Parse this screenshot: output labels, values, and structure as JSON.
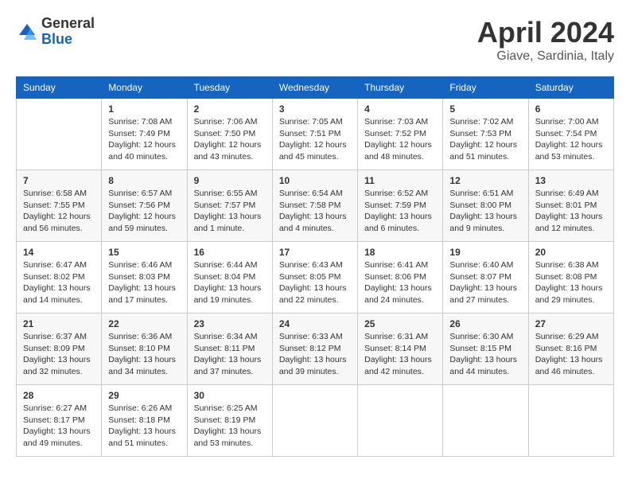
{
  "header": {
    "logo_general": "General",
    "logo_blue": "Blue",
    "month_title": "April 2024",
    "location": "Giave, Sardinia, Italy"
  },
  "days_of_week": [
    "Sunday",
    "Monday",
    "Tuesday",
    "Wednesday",
    "Thursday",
    "Friday",
    "Saturday"
  ],
  "weeks": [
    [
      {
        "day": "",
        "sunrise": "",
        "sunset": "",
        "daylight": ""
      },
      {
        "day": "1",
        "sunrise": "Sunrise: 7:08 AM",
        "sunset": "Sunset: 7:49 PM",
        "daylight": "Daylight: 12 hours and 40 minutes."
      },
      {
        "day": "2",
        "sunrise": "Sunrise: 7:06 AM",
        "sunset": "Sunset: 7:50 PM",
        "daylight": "Daylight: 12 hours and 43 minutes."
      },
      {
        "day": "3",
        "sunrise": "Sunrise: 7:05 AM",
        "sunset": "Sunset: 7:51 PM",
        "daylight": "Daylight: 12 hours and 45 minutes."
      },
      {
        "day": "4",
        "sunrise": "Sunrise: 7:03 AM",
        "sunset": "Sunset: 7:52 PM",
        "daylight": "Daylight: 12 hours and 48 minutes."
      },
      {
        "day": "5",
        "sunrise": "Sunrise: 7:02 AM",
        "sunset": "Sunset: 7:53 PM",
        "daylight": "Daylight: 12 hours and 51 minutes."
      },
      {
        "day": "6",
        "sunrise": "Sunrise: 7:00 AM",
        "sunset": "Sunset: 7:54 PM",
        "daylight": "Daylight: 12 hours and 53 minutes."
      }
    ],
    [
      {
        "day": "7",
        "sunrise": "Sunrise: 6:58 AM",
        "sunset": "Sunset: 7:55 PM",
        "daylight": "Daylight: 12 hours and 56 minutes."
      },
      {
        "day": "8",
        "sunrise": "Sunrise: 6:57 AM",
        "sunset": "Sunset: 7:56 PM",
        "daylight": "Daylight: 12 hours and 59 minutes."
      },
      {
        "day": "9",
        "sunrise": "Sunrise: 6:55 AM",
        "sunset": "Sunset: 7:57 PM",
        "daylight": "Daylight: 13 hours and 1 minute."
      },
      {
        "day": "10",
        "sunrise": "Sunrise: 6:54 AM",
        "sunset": "Sunset: 7:58 PM",
        "daylight": "Daylight: 13 hours and 4 minutes."
      },
      {
        "day": "11",
        "sunrise": "Sunrise: 6:52 AM",
        "sunset": "Sunset: 7:59 PM",
        "daylight": "Daylight: 13 hours and 6 minutes."
      },
      {
        "day": "12",
        "sunrise": "Sunrise: 6:51 AM",
        "sunset": "Sunset: 8:00 PM",
        "daylight": "Daylight: 13 hours and 9 minutes."
      },
      {
        "day": "13",
        "sunrise": "Sunrise: 6:49 AM",
        "sunset": "Sunset: 8:01 PM",
        "daylight": "Daylight: 13 hours and 12 minutes."
      }
    ],
    [
      {
        "day": "14",
        "sunrise": "Sunrise: 6:47 AM",
        "sunset": "Sunset: 8:02 PM",
        "daylight": "Daylight: 13 hours and 14 minutes."
      },
      {
        "day": "15",
        "sunrise": "Sunrise: 6:46 AM",
        "sunset": "Sunset: 8:03 PM",
        "daylight": "Daylight: 13 hours and 17 minutes."
      },
      {
        "day": "16",
        "sunrise": "Sunrise: 6:44 AM",
        "sunset": "Sunset: 8:04 PM",
        "daylight": "Daylight: 13 hours and 19 minutes."
      },
      {
        "day": "17",
        "sunrise": "Sunrise: 6:43 AM",
        "sunset": "Sunset: 8:05 PM",
        "daylight": "Daylight: 13 hours and 22 minutes."
      },
      {
        "day": "18",
        "sunrise": "Sunrise: 6:41 AM",
        "sunset": "Sunset: 8:06 PM",
        "daylight": "Daylight: 13 hours and 24 minutes."
      },
      {
        "day": "19",
        "sunrise": "Sunrise: 6:40 AM",
        "sunset": "Sunset: 8:07 PM",
        "daylight": "Daylight: 13 hours and 27 minutes."
      },
      {
        "day": "20",
        "sunrise": "Sunrise: 6:38 AM",
        "sunset": "Sunset: 8:08 PM",
        "daylight": "Daylight: 13 hours and 29 minutes."
      }
    ],
    [
      {
        "day": "21",
        "sunrise": "Sunrise: 6:37 AM",
        "sunset": "Sunset: 8:09 PM",
        "daylight": "Daylight: 13 hours and 32 minutes."
      },
      {
        "day": "22",
        "sunrise": "Sunrise: 6:36 AM",
        "sunset": "Sunset: 8:10 PM",
        "daylight": "Daylight: 13 hours and 34 minutes."
      },
      {
        "day": "23",
        "sunrise": "Sunrise: 6:34 AM",
        "sunset": "Sunset: 8:11 PM",
        "daylight": "Daylight: 13 hours and 37 minutes."
      },
      {
        "day": "24",
        "sunrise": "Sunrise: 6:33 AM",
        "sunset": "Sunset: 8:12 PM",
        "daylight": "Daylight: 13 hours and 39 minutes."
      },
      {
        "day": "25",
        "sunrise": "Sunrise: 6:31 AM",
        "sunset": "Sunset: 8:14 PM",
        "daylight": "Daylight: 13 hours and 42 minutes."
      },
      {
        "day": "26",
        "sunrise": "Sunrise: 6:30 AM",
        "sunset": "Sunset: 8:15 PM",
        "daylight": "Daylight: 13 hours and 44 minutes."
      },
      {
        "day": "27",
        "sunrise": "Sunrise: 6:29 AM",
        "sunset": "Sunset: 8:16 PM",
        "daylight": "Daylight: 13 hours and 46 minutes."
      }
    ],
    [
      {
        "day": "28",
        "sunrise": "Sunrise: 6:27 AM",
        "sunset": "Sunset: 8:17 PM",
        "daylight": "Daylight: 13 hours and 49 minutes."
      },
      {
        "day": "29",
        "sunrise": "Sunrise: 6:26 AM",
        "sunset": "Sunset: 8:18 PM",
        "daylight": "Daylight: 13 hours and 51 minutes."
      },
      {
        "day": "30",
        "sunrise": "Sunrise: 6:25 AM",
        "sunset": "Sunset: 8:19 PM",
        "daylight": "Daylight: 13 hours and 53 minutes."
      },
      {
        "day": "",
        "sunrise": "",
        "sunset": "",
        "daylight": ""
      },
      {
        "day": "",
        "sunrise": "",
        "sunset": "",
        "daylight": ""
      },
      {
        "day": "",
        "sunrise": "",
        "sunset": "",
        "daylight": ""
      },
      {
        "day": "",
        "sunrise": "",
        "sunset": "",
        "daylight": ""
      }
    ]
  ]
}
